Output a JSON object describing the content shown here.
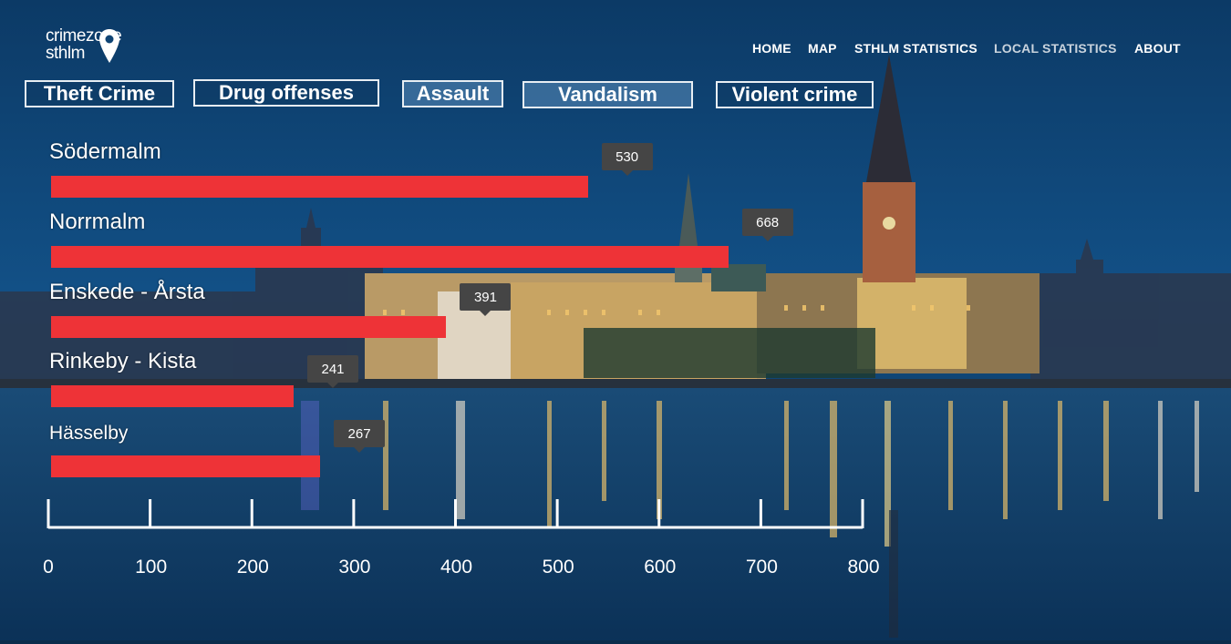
{
  "logo": {
    "line1": "crimezone",
    "line2": "sthlm"
  },
  "nav": [
    {
      "label": "HOME",
      "active": false
    },
    {
      "label": "MAP",
      "active": false
    },
    {
      "label": "STHLM STATISTICS",
      "active": false
    },
    {
      "label": "LOCAL STATISTICS",
      "active": true
    },
    {
      "label": "ABOUT",
      "active": false
    }
  ],
  "categories": [
    {
      "label": "Theft Crime",
      "selected": false
    },
    {
      "label": "Drug offenses",
      "selected": false
    },
    {
      "label": "Assault",
      "selected": true
    },
    {
      "label": "Vandalism",
      "selected": true
    },
    {
      "label": "Violent crime",
      "selected": false
    }
  ],
  "chart_data": {
    "type": "bar",
    "orientation": "horizontal",
    "categories": [
      "Södermalm",
      "Norrmalm",
      "Enskede - Årsta",
      "Rinkeby - Kista",
      "Hässelby"
    ],
    "values": [
      530,
      668,
      391,
      241,
      267
    ],
    "value_labels": [
      "530",
      "668",
      "391",
      "241",
      "267"
    ],
    "xlim": [
      0,
      800
    ],
    "ticks": [
      0,
      100,
      200,
      300,
      400,
      500,
      600,
      700,
      800
    ],
    "tick_labels": [
      "0",
      "100",
      "200",
      "300",
      "400",
      "500",
      "600",
      "700",
      "800"
    ],
    "bar_color": "#ee3337",
    "grid": false
  },
  "colors": {
    "accent": "#ee3337",
    "tooltip": "#454545",
    "background": "#0d3a63"
  }
}
